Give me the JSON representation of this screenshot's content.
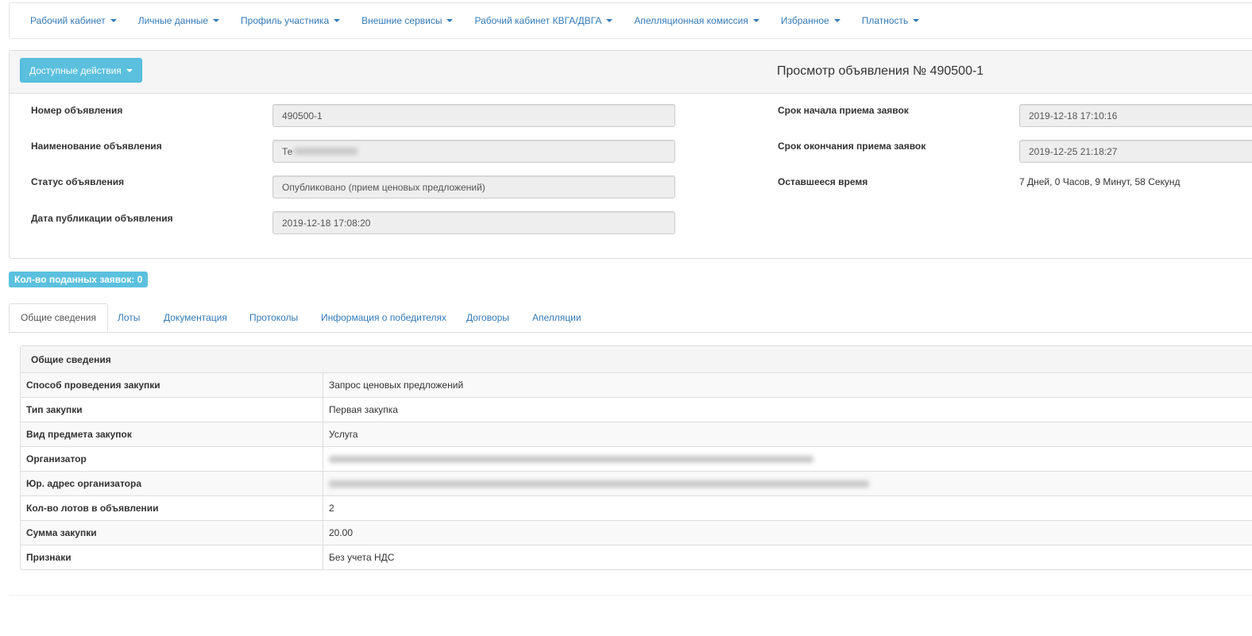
{
  "nav": {
    "items": [
      {
        "label": "Рабочий кабинет"
      },
      {
        "label": "Личные данные"
      },
      {
        "label": "Профиль участника"
      },
      {
        "label": "Внешние сервисы"
      },
      {
        "label": "Рабочий кабинет КВГА/ДВГА"
      },
      {
        "label": "Апелляционная комиссия"
      },
      {
        "label": "Избранное"
      },
      {
        "label": "Платность"
      }
    ]
  },
  "header": {
    "actions_label": "Доступные действия",
    "title": "Просмотр объявления № 490500-1"
  },
  "fields": {
    "number_label": "Номер объявления",
    "number_value": "490500-1",
    "name_label": "Наименование объявления",
    "name_value": "Те",
    "status_label": "Статус объявления",
    "status_value": "Опубликовано (прием ценовых предложений)",
    "pubdate_label": "Дата публикации объявления",
    "pubdate_value": "2019-12-18 17:08:20",
    "start_label": "Срок начала приема заявок",
    "start_value": "2019-12-18 17:10:16",
    "end_label": "Срок окончания приема заявок",
    "end_value": "2019-12-25 21:18:27",
    "remaining_label": "Оставшееся время",
    "remaining_value": "7 Дней, 0 Часов, 9 Минут, 58 Секунд"
  },
  "badge": "Кол-во поданных заявок: 0",
  "tabs": [
    {
      "label": "Общие сведения",
      "active": true
    },
    {
      "label": "Лоты"
    },
    {
      "label": "Документация"
    },
    {
      "label": "Протоколы"
    },
    {
      "label": "Информация о победителях"
    },
    {
      "label": "Договоры"
    },
    {
      "label": "Апелляции"
    }
  ],
  "info": {
    "heading": "Общие сведения",
    "rows": [
      {
        "key": "Способ проведения закупки",
        "value": "Запрос ценовых предложений"
      },
      {
        "key": "Тип закупки",
        "value": "Первая закупка"
      },
      {
        "key": "Вид предмета закупок",
        "value": "Услуга"
      },
      {
        "key": "Организатор",
        "value": ""
      },
      {
        "key": "Юр. адрес организатора",
        "value": ""
      },
      {
        "key": "Кол-во лотов в объявлении",
        "value": "2"
      },
      {
        "key": "Сумма закупки",
        "value": "20.00"
      },
      {
        "key": "Признаки",
        "value": "Без учета НДС"
      }
    ]
  },
  "colors": {
    "accent": "#5bc0de",
    "link": "#337ab7"
  }
}
